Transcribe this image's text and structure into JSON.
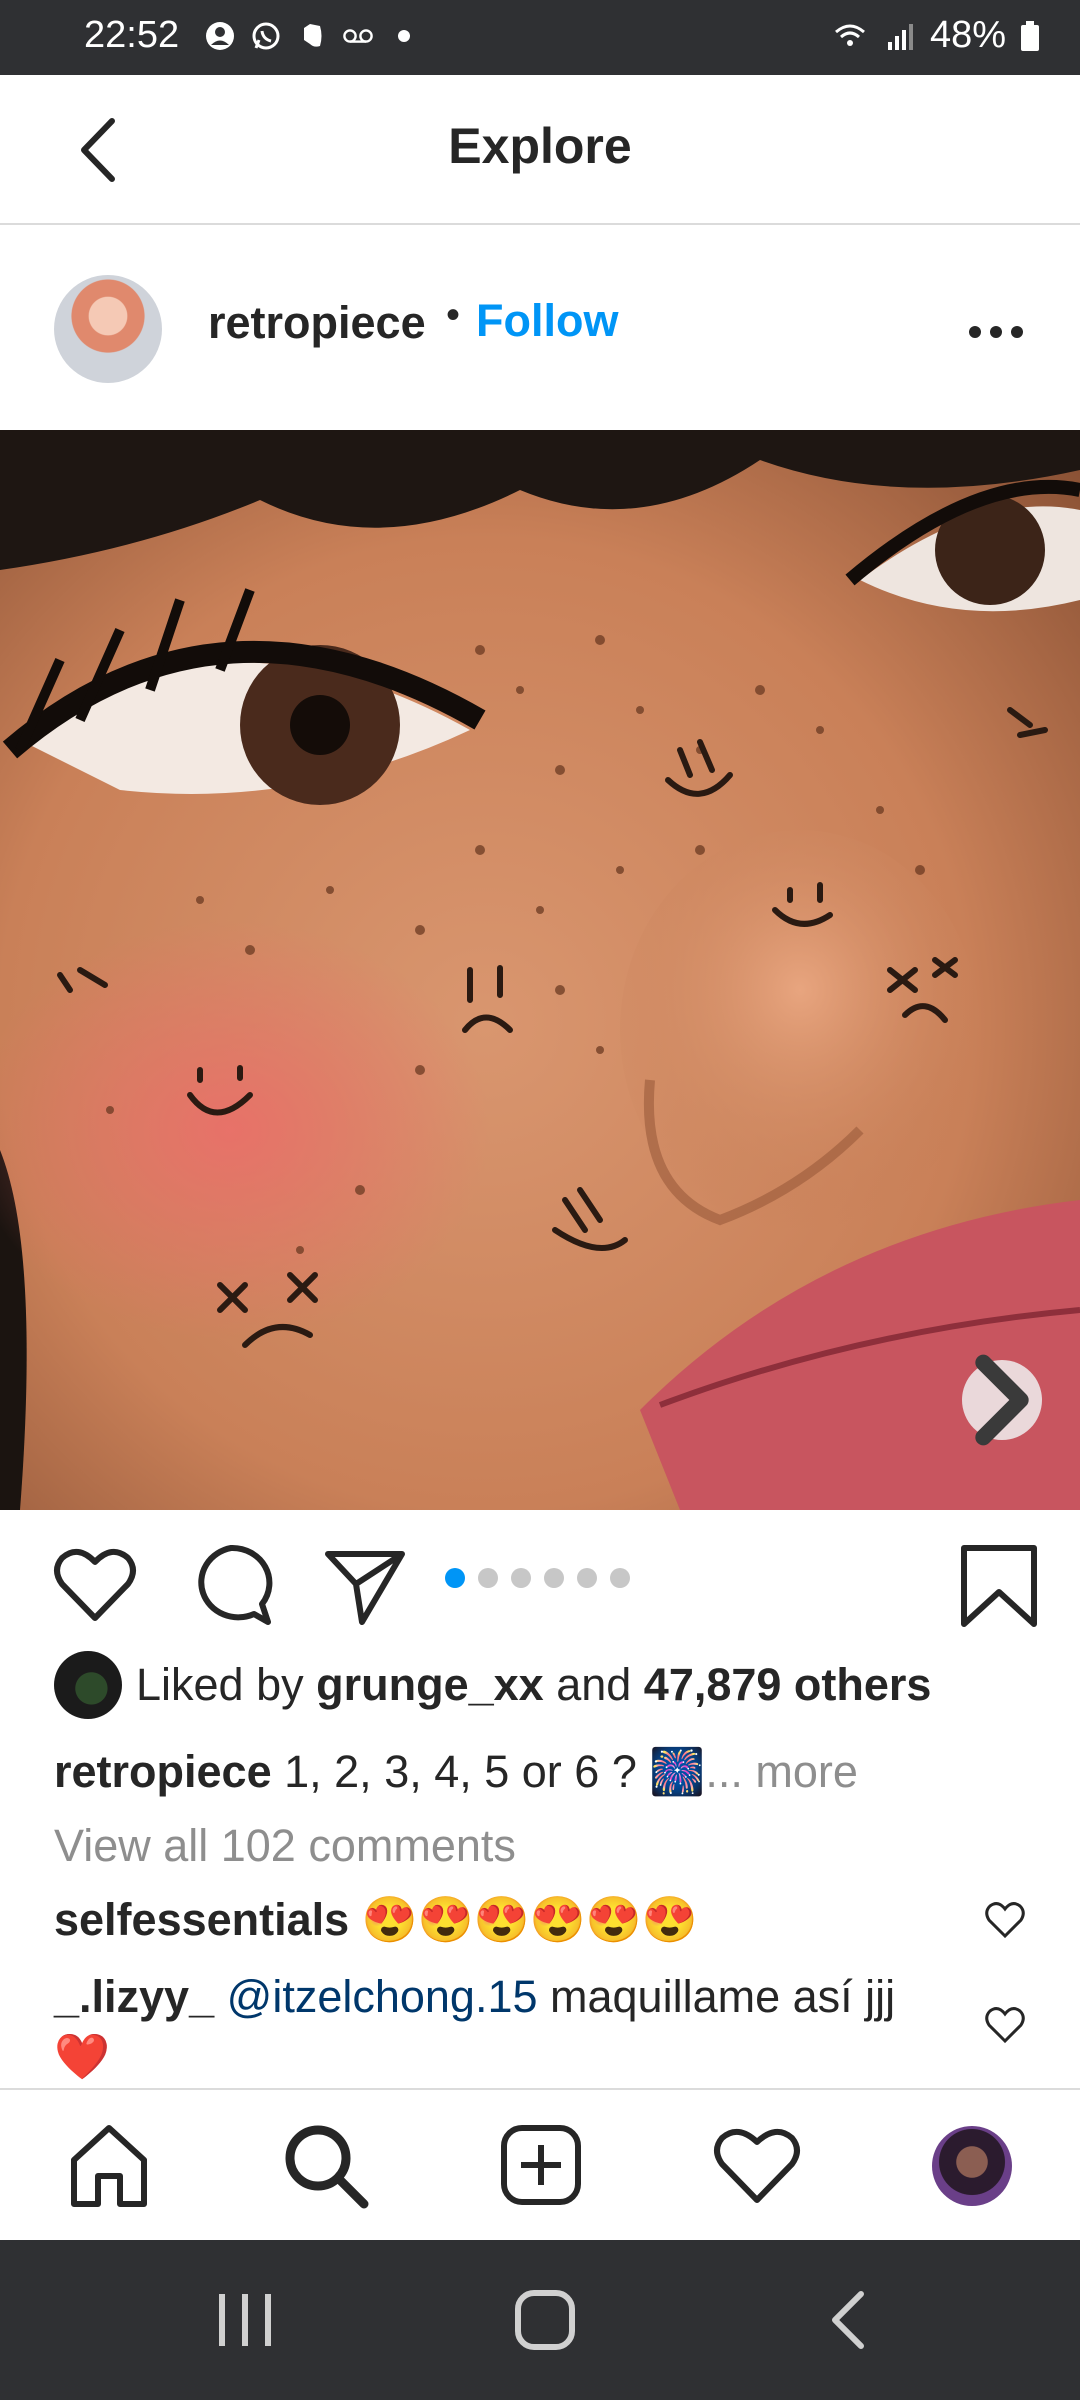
{
  "status_bar": {
    "time": "22:52",
    "battery": "48%",
    "icons": [
      "avatar-badge-icon",
      "whatsapp-icon",
      "evernote-icon",
      "voicemail-icon",
      "dot-icon",
      "wifi-icon",
      "signal-icon",
      "battery-icon"
    ]
  },
  "header": {
    "title": "Explore",
    "back_icon": "back-arrow-icon"
  },
  "post": {
    "username": "retropiece",
    "separator": "•",
    "follow_label": "Follow",
    "more_icon": "more-dots-icon",
    "carousel": {
      "total": 6,
      "active": 1
    },
    "likes": {
      "prefix": "Liked by ",
      "user": "grunge_xx",
      "and": " and ",
      "others": "47,879 others"
    },
    "caption": {
      "username": "retropiece",
      "text": "1, 2, 3, 4, 5 or 6 ? 🎆",
      "more": "... more"
    },
    "view_comments": "View all 102 comments",
    "comments": [
      {
        "username": "selfessentials",
        "text": "😍😍😍😍😍😍"
      },
      {
        "username": "_.lizyy_",
        "mention": "@itzelchong.15",
        "text": " maquillame así jjj ❤️"
      }
    ]
  },
  "bottom_nav": {
    "items": [
      "home-icon",
      "search-icon",
      "new-post-icon",
      "activity-heart-icon",
      "profile-avatar"
    ]
  },
  "system_nav": {
    "items": [
      "recents-icon",
      "home-circle-icon",
      "back-chevron-icon"
    ]
  },
  "colors": {
    "accent": "#0095f6",
    "text": "#262626",
    "muted": "#8e8e8e",
    "mention": "#00376b",
    "system_bar": "#2f3033"
  }
}
